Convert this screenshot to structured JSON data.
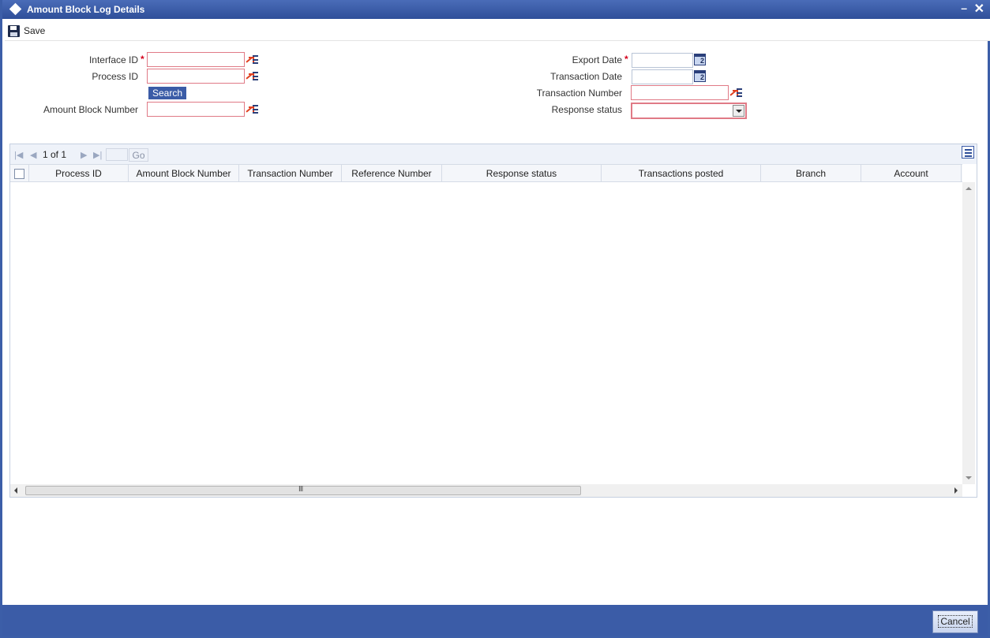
{
  "window": {
    "title": "Amount Block Log Details",
    "minimize_glyph": "–",
    "close_glyph": "✕",
    "accent_color": "#3b5ca7"
  },
  "toolbar": {
    "save_label": "Save"
  },
  "form": {
    "interface_id_label": "Interface ID",
    "process_id_label": "Process ID",
    "amount_block_number_label": "Amount Block Number",
    "search_label": "Search",
    "export_date_label": "Export Date",
    "transaction_date_label": "Transaction Date",
    "transaction_number_label": "Transaction Number",
    "response_status_label": "Response status",
    "required_mark": "*",
    "interface_id_value": "",
    "process_id_value": "",
    "amount_block_number_value": "",
    "export_date_value": "",
    "transaction_date_value": "",
    "transaction_number_value": "",
    "response_status_value": ""
  },
  "grid": {
    "pager_text": "1 of 1",
    "go_label": "Go",
    "columns": [
      "Process ID",
      "Amount Block Number",
      "Transaction Number",
      "Reference Number",
      "Response status",
      "Transactions posted",
      "Branch",
      "Account"
    ],
    "rows": []
  },
  "footer": {
    "cancel_label": "Cancel"
  }
}
